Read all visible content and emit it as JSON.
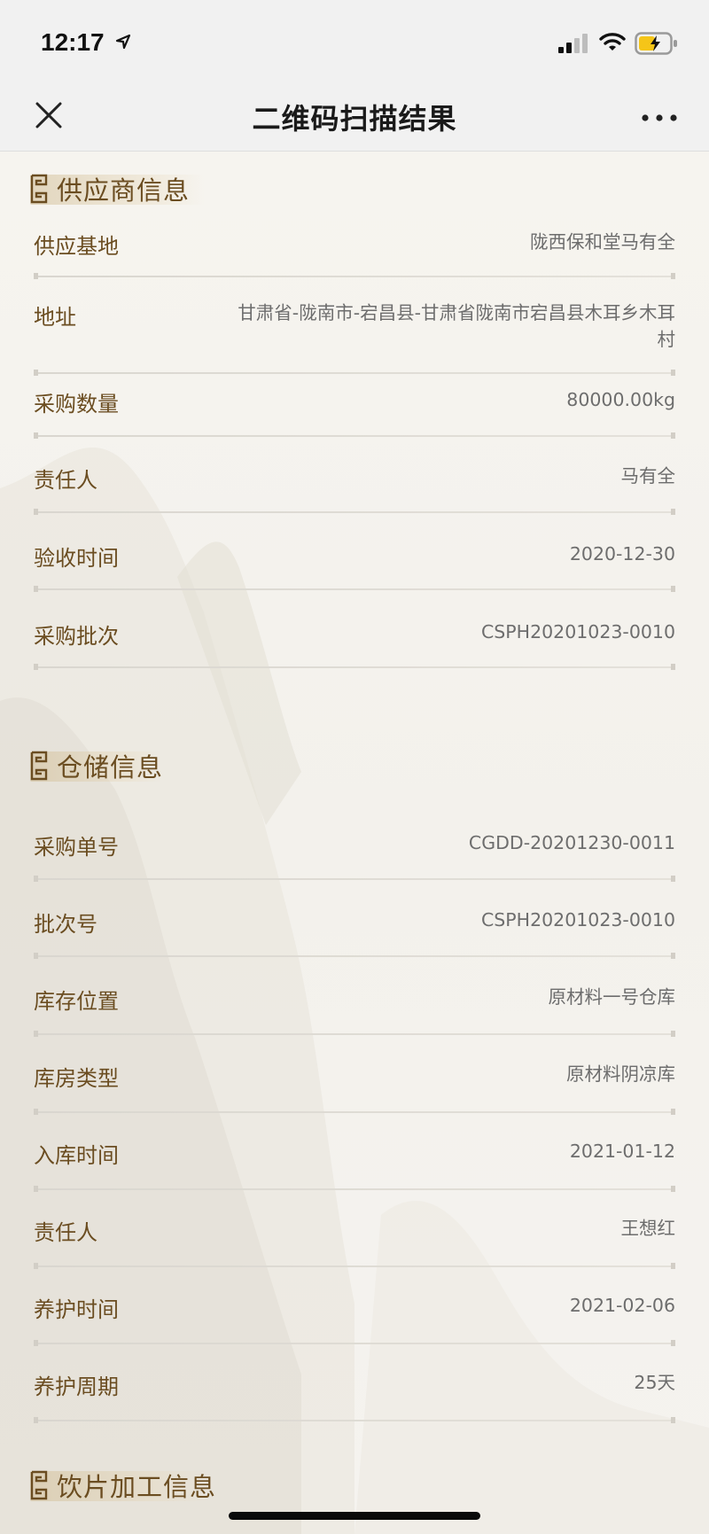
{
  "status_bar": {
    "time": "12:17"
  },
  "nav": {
    "title": "二维码扫描结果"
  },
  "sections": {
    "supplier": {
      "title": "供应商信息",
      "rows": [
        {
          "label": "供应基地",
          "value": "陇西保和堂马有全"
        },
        {
          "label": "地址",
          "value": "甘肃省-陇南市-宕昌县-甘肃省陇南市宕昌县木耳乡木耳村"
        },
        {
          "label": "采购数量",
          "value": "80000.00kg"
        },
        {
          "label": "责任人",
          "value": "马有全"
        },
        {
          "label": "验收时间",
          "value": "2020-12-30"
        },
        {
          "label": "采购批次",
          "value": "CSPH20201023-0010"
        }
      ]
    },
    "storage": {
      "title": "仓储信息",
      "rows": [
        {
          "label": "采购单号",
          "value": "CGDD-20201230-0011"
        },
        {
          "label": "批次号",
          "value": "CSPH20201023-0010"
        },
        {
          "label": "库存位置",
          "value": "原材料一号仓库"
        },
        {
          "label": "库房类型",
          "value": "原材料阴凉库"
        },
        {
          "label": "入库时间",
          "value": "2021-01-12"
        },
        {
          "label": "责任人",
          "value": "王想红"
        },
        {
          "label": "养护时间",
          "value": "2021-02-06"
        },
        {
          "label": "养护周期",
          "value": "25天"
        }
      ]
    },
    "processing": {
      "title": "饮片加工信息"
    }
  },
  "colors": {
    "accent": "#6b4d21",
    "value_text": "#6d6d6d",
    "nav_bg": "#f1f1f1",
    "battery": "#f5c518"
  },
  "icons": [
    "location-arrow-icon",
    "signal-icon",
    "wifi-icon",
    "battery-charging-icon",
    "close-icon",
    "more-icon",
    "fret-pattern-icon"
  ]
}
